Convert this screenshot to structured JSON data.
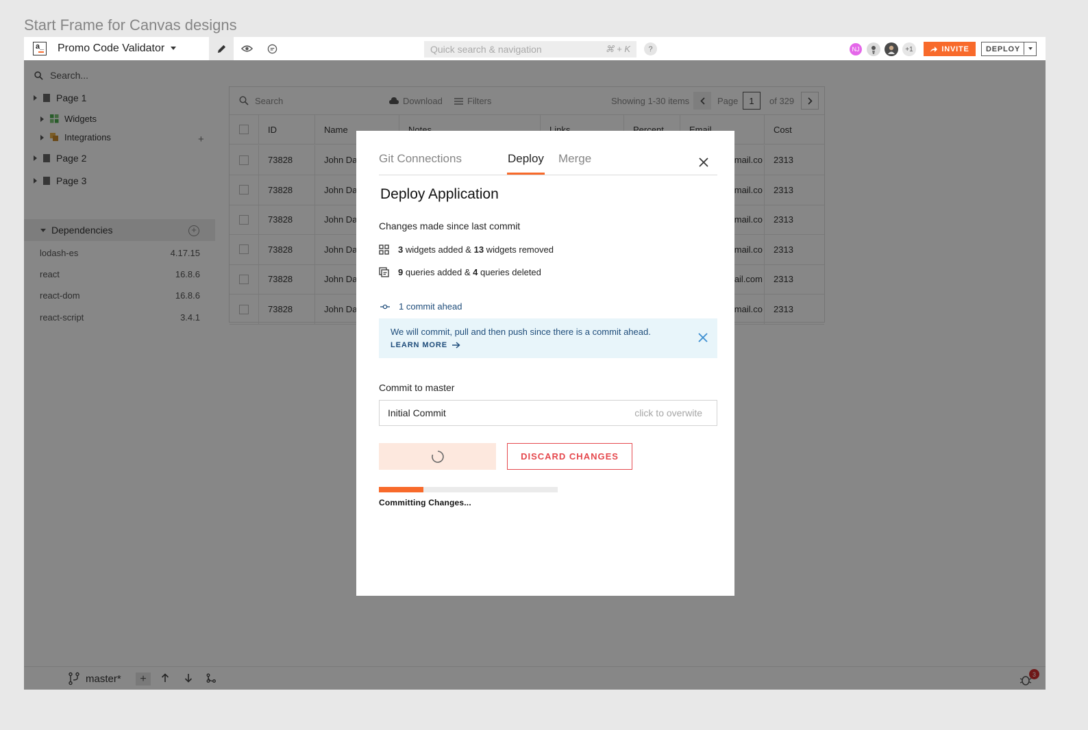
{
  "frame_title": "Start Frame for Canvas designs",
  "topbar": {
    "logo_text": "a_",
    "app_name": "Promo Code Validator",
    "quick_search_placeholder": "Quick search & navigation",
    "quick_search_shortcut": "⌘ + K",
    "help_label": "?",
    "avatars": [
      "NJ"
    ],
    "extra_users": "+1",
    "invite_label": "INVITE",
    "deploy_label": "DEPLOY"
  },
  "sidebar": {
    "search_placeholder": "Search...",
    "pages": [
      {
        "label": "Page 1"
      },
      {
        "label": "Widgets"
      },
      {
        "label": "Integrations"
      },
      {
        "label": "Page 2"
      },
      {
        "label": "Page 3"
      }
    ],
    "dependencies_label": "Dependencies",
    "dependencies": [
      {
        "name": "lodash-es",
        "version": "4.17.15"
      },
      {
        "name": "react",
        "version": "16.8.6"
      },
      {
        "name": "react-dom",
        "version": "16.8.6"
      },
      {
        "name": "react-script",
        "version": "3.4.1"
      }
    ]
  },
  "table": {
    "search_placeholder": "Search",
    "download_label": "Download",
    "filters_label": "Filters",
    "showing": "Showing 1-30 items",
    "page_label": "Page",
    "page_number": "1",
    "page_total": "of 329",
    "columns": [
      "ID",
      "Name",
      "Notes",
      "Links",
      "Percent",
      "Email",
      "Cost"
    ],
    "rows": [
      {
        "id": "73828",
        "name": "John Da",
        "email": "gmail.co",
        "cost": "2313"
      },
      {
        "id": "73828",
        "name": "John Da",
        "email": "gmail.co",
        "cost": "2313"
      },
      {
        "id": "73828",
        "name": "John Da",
        "email": "gmail.co",
        "cost": "2313"
      },
      {
        "id": "73828",
        "name": "John Da",
        "email": "gmail.co",
        "cost": "2313"
      },
      {
        "id": "73828",
        "name": "John Da",
        "email": "mail.com",
        "cost": "2313"
      },
      {
        "id": "73828",
        "name": "John Da",
        "email": "gmail.co",
        "cost": "2313"
      }
    ]
  },
  "bottombar": {
    "branch": "master*",
    "notification_count": "3"
  },
  "modal": {
    "tabs": [
      "Git Connections",
      "Deploy",
      "Merge"
    ],
    "active_tab": "Deploy",
    "title": "Deploy Application",
    "changes_heading": "Changes made since last commit",
    "widgets_added": "3",
    "widgets_added_text": " widgets added & ",
    "widgets_removed": "13",
    "widgets_removed_text": " widgets removed",
    "queries_added": "9",
    "queries_added_text": " queries added & ",
    "queries_deleted": "4",
    "queries_deleted_text": " queries deleted",
    "commit_ahead": "1 commit ahead",
    "info_message": "We will commit, pull and then push since there is a commit ahead.",
    "learn_more": "LEARN MORE",
    "commit_label": "Commit to master",
    "commit_value": "Initial Commit",
    "commit_hint": "click to overwite",
    "discard_label": "DISCARD CHANGES",
    "progress": 0.25,
    "progress_label": "Committing Changes..."
  },
  "colors": {
    "accent": "#f86a2b",
    "info_bg": "#e8f5fa",
    "info_text": "#1e4c7a",
    "danger": "#e5484d"
  }
}
